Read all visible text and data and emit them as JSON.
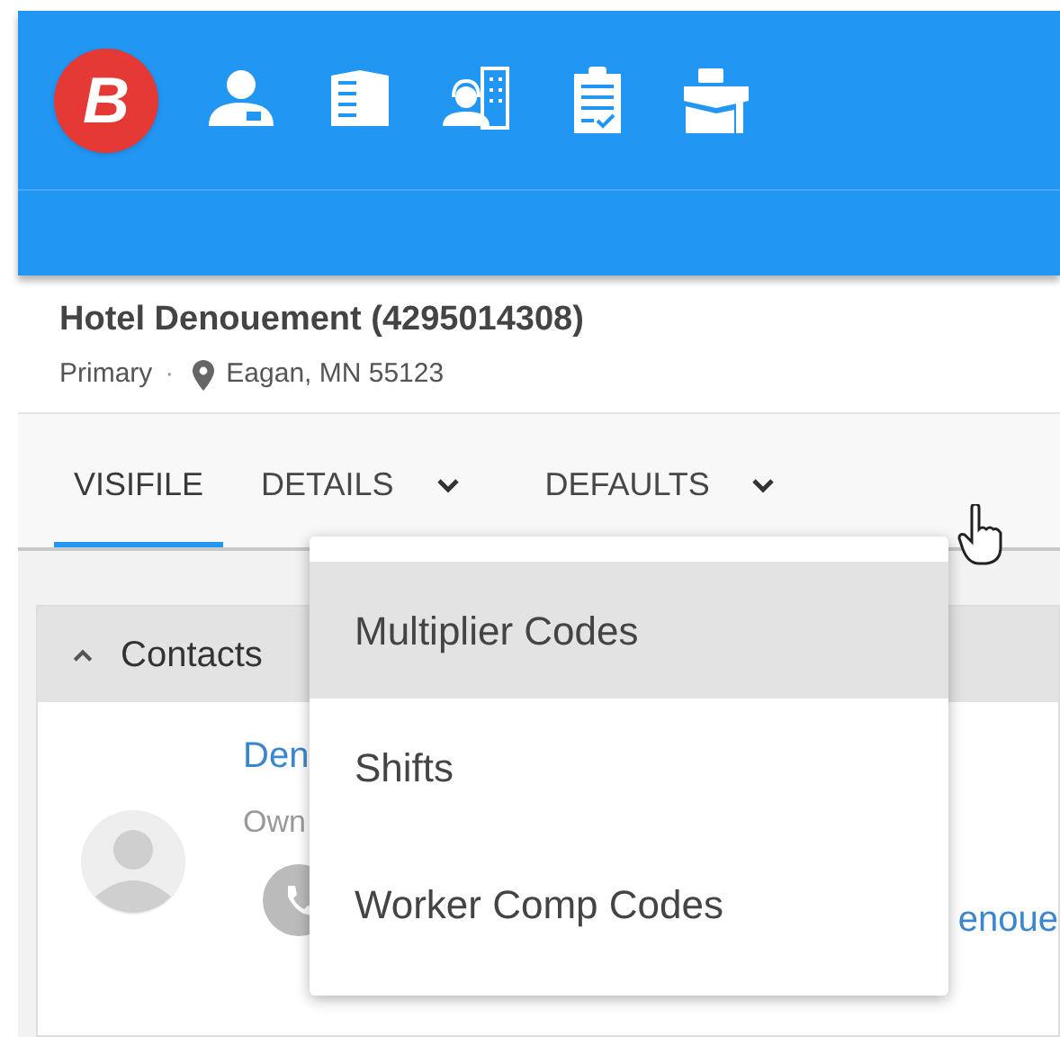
{
  "app_bar": {
    "logo_letter": "B",
    "nav_icons": [
      {
        "kind": "person"
      },
      {
        "kind": "building"
      },
      {
        "kind": "support"
      },
      {
        "kind": "clipboard"
      },
      {
        "kind": "briefcase"
      }
    ]
  },
  "company": {
    "name": "Hotel Denouement (4295014308)",
    "type": "Primary",
    "separator": "·",
    "location": "Eagan, MN 55123"
  },
  "tabs": [
    {
      "label": "VISIFILE",
      "selected": true,
      "has_menu": false
    },
    {
      "label": "DETAILS",
      "selected": false,
      "has_menu": true
    },
    {
      "label": "DEFAULTS",
      "selected": false,
      "has_menu": true
    }
  ],
  "contacts": {
    "title": "Contacts",
    "expanded": true,
    "contact": {
      "name": "Den",
      "role": "Own",
      "email": "enoue"
    }
  },
  "dropdown": {
    "items": [
      {
        "label": "Multiplier Codes",
        "selected": true
      },
      {
        "label": "Shifts",
        "selected": false
      },
      {
        "label": "Worker Comp Codes",
        "selected": false
      }
    ]
  }
}
